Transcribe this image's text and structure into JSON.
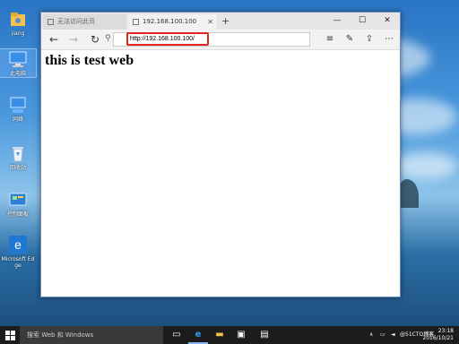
{
  "desktop": {
    "icons": [
      {
        "label": "jiang",
        "icon": "user-folder-icon"
      },
      {
        "label": "此电脑",
        "icon": "computer-icon"
      },
      {
        "label": "网络",
        "icon": "network-icon"
      },
      {
        "label": "回收站",
        "icon": "recycle-bin-icon"
      },
      {
        "label": "控制面板",
        "icon": "control-panel-icon"
      },
      {
        "label": "Microsoft Edge",
        "icon": "edge-icon"
      }
    ]
  },
  "browser": {
    "tabs": [
      {
        "label": "无法访问此页",
        "active": false
      },
      {
        "label": "192.168.100.100",
        "active": true
      }
    ],
    "new_tab": "+",
    "window_controls": {
      "minimize": "—",
      "maximize": "☐",
      "close": "✕"
    },
    "nav": {
      "back": "←",
      "forward": "→",
      "refresh": "↻"
    },
    "address": "http://192.168.100.100/",
    "tools": {
      "hub": "≡",
      "note": "✎",
      "share": "⇪",
      "more": "⋯"
    },
    "page": {
      "heading": "this is test web"
    }
  },
  "taskbar": {
    "search_label": "搜索 Web 和 Windows",
    "clock_time": "23:18",
    "clock_date": "2016/10/21",
    "tray_brand": "@51CTO博客"
  },
  "colors": {
    "accent": "#0078d7",
    "highlight_border": "#e0271f",
    "taskbar": "#1c1c1c"
  }
}
